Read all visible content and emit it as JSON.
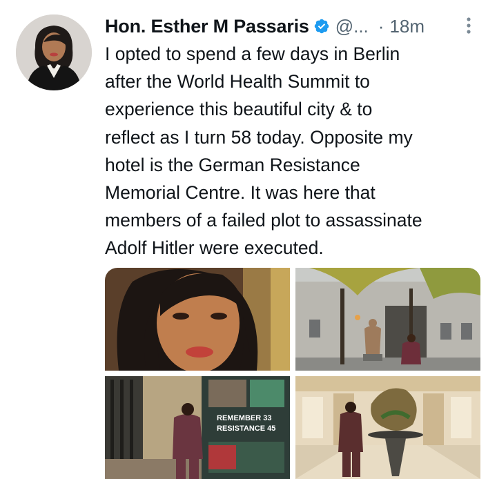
{
  "author": {
    "display_name": "Hon. Esther M Passaris",
    "handle": "@...",
    "time_separator": "·",
    "time": "18m",
    "avatar_icon": "profile-photo",
    "verified_icon": "verified-badge-icon",
    "verified_color": "#1d9bf0"
  },
  "tweet": {
    "text": "I opted to spend a few days in Berlin\nafter the World Health Summit to\nexperience this beautiful city & to\nreflect as I turn 58 today. Opposite my\nhotel is the German Resistance\nMemorial Centre. It was here that\nmembers of a failed plot to assassinate\nAdolf Hitler were executed."
  },
  "media": {
    "photos": [
      {
        "description_icon": "selfie-photo"
      },
      {
        "description_icon": "memorial-courtyard-photo"
      },
      {
        "description_icon": "exhibition-poster-photo",
        "poster_line1": "REMEMBER 33",
        "poster_line2": "RESISTANCE 45"
      },
      {
        "description_icon": "hotel-lobby-photo"
      }
    ]
  },
  "colors": {
    "text_primary": "#0f1419",
    "text_secondary": "#536471"
  }
}
